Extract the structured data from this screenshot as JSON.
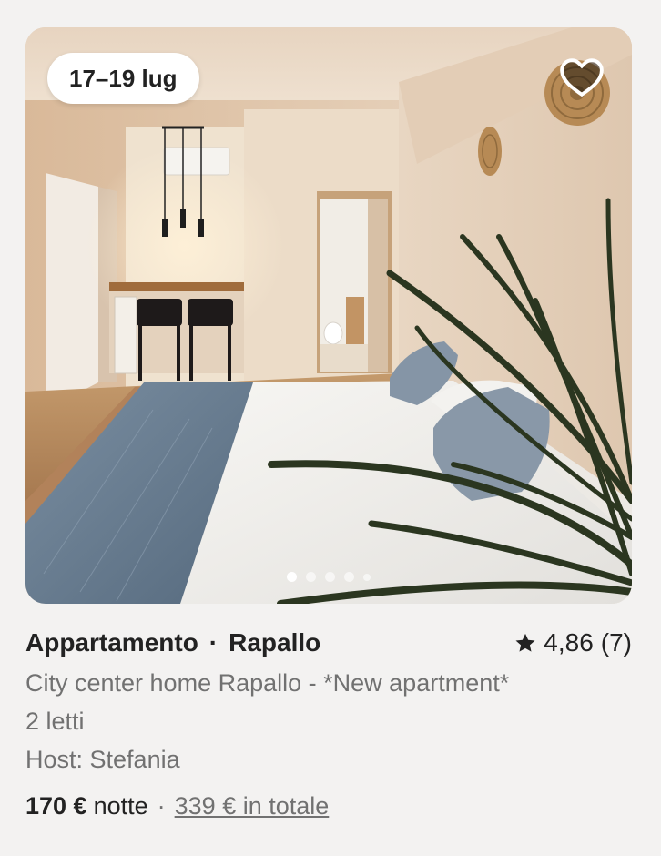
{
  "listing": {
    "dates": "17–19 lug",
    "property_type": "Appartamento",
    "title_separator": "·",
    "location": "Rapallo",
    "rating": "4,86",
    "reviews": "(7)",
    "name": "City center home Rapallo - *New apartment*",
    "beds": "2 letti",
    "host": "Host: Stefania",
    "price": "170 €",
    "price_unit": "notte",
    "price_separator": "·",
    "total": "339 € in totale"
  },
  "photo": {
    "dots": 5,
    "active_dot": 0,
    "icons": {
      "favorite": "heart-icon",
      "rating": "star-icon"
    }
  },
  "colors": {
    "background": "#f3f2f1",
    "text_primary": "#222222",
    "text_secondary": "#717171",
    "wall": "#e9d7c4",
    "floor": "#b98b5e",
    "blanket": "#6b7f93",
    "plant": "#2d3a1e"
  }
}
